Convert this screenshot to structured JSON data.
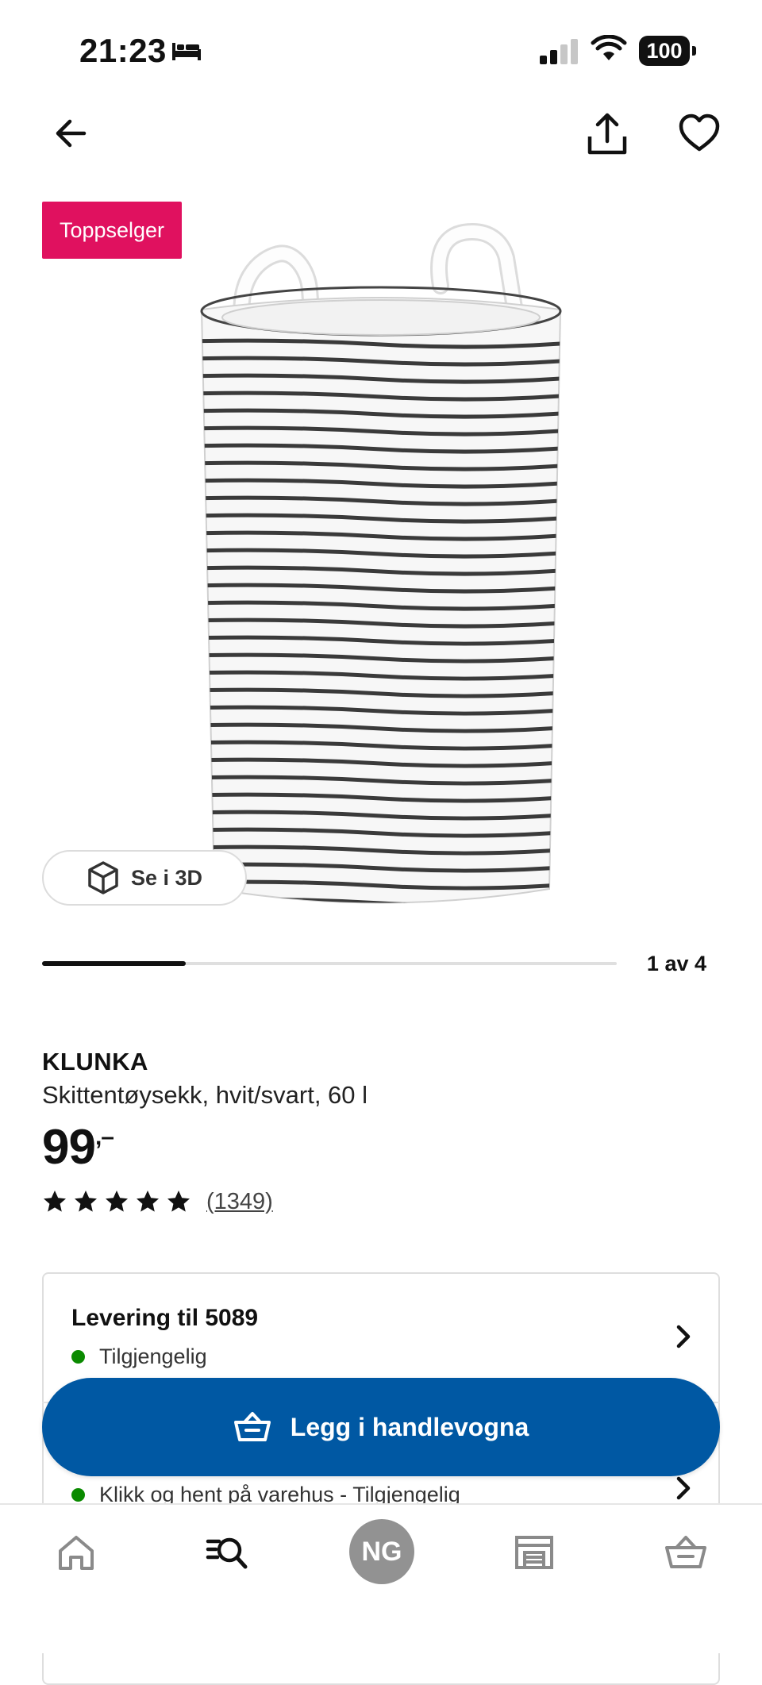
{
  "status_bar": {
    "time": "21:23",
    "battery": "100"
  },
  "badge": {
    "label": "Toppselger"
  },
  "view_3d": {
    "label": "Se i 3D"
  },
  "carousel": {
    "counter": "1 av 4",
    "current": 1,
    "total": 4
  },
  "product": {
    "brand": "KLUNKA",
    "description": "Skittentøysekk, hvit/svart, 60 l",
    "price": "99",
    "price_suffix": ",–",
    "rating": 5,
    "review_count": "(1349)"
  },
  "delivery": {
    "title": "Levering til 5089",
    "status": "Tilgjengelig",
    "pickup_status": "Klikk og hent på varehus - Tilgjengelig"
  },
  "cart_button": {
    "label": "Legg i handlevogna"
  },
  "bottom_nav": {
    "avatar_initials": "NG",
    "items": [
      "home-icon",
      "search-icon",
      "avatar",
      "store-icon",
      "basket-icon"
    ]
  },
  "colors": {
    "badge": "#e0115f",
    "primary": "#0058a3",
    "available": "#0a8a00"
  }
}
